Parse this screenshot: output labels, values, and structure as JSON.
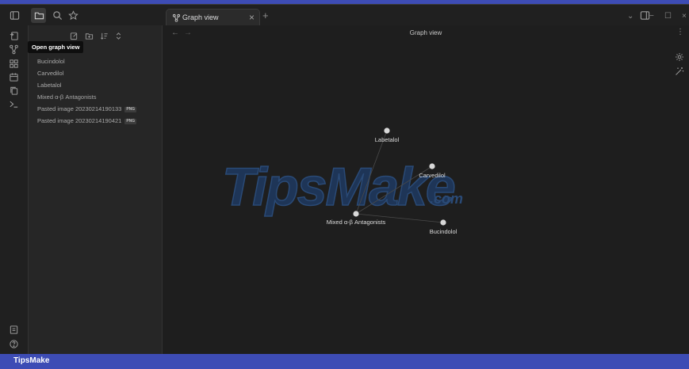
{
  "tab": {
    "label": "Graph view",
    "close": "×",
    "new": "+"
  },
  "tooltip": "Open graph view",
  "files": [
    {
      "name": "Bucindolol"
    },
    {
      "name": "Carvedilol"
    },
    {
      "name": "Labetalol"
    },
    {
      "name": "Mixed α-β Antagonists"
    },
    {
      "name": "Pasted image 20230214190133",
      "badge": "PNG"
    },
    {
      "name": "Pasted image 20230214190421",
      "badge": "PNG"
    }
  ],
  "graph": {
    "title": "Graph view",
    "nav_back": "←",
    "nav_fwd": "→",
    "more": "⋮",
    "nodes": [
      {
        "id": "labetalol",
        "label": "Labetalol"
      },
      {
        "id": "carvedilol",
        "label": "Carvedilol"
      },
      {
        "id": "mixed",
        "label": "Mixed α-β Antagonists"
      },
      {
        "id": "bucindolol",
        "label": "Bucindolol"
      }
    ],
    "edges": [
      [
        "labetalol",
        "mixed"
      ],
      [
        "carvedilol",
        "mixed"
      ],
      [
        "bucindolol",
        "mixed"
      ]
    ],
    "colors": {
      "node": "#d8d8d8",
      "edge": "#4a4a4a",
      "background": "#1e1e1e"
    }
  },
  "window": {
    "minimize": "−",
    "maximize": "☐",
    "close": "×",
    "chevron": "⌄"
  },
  "watermark": {
    "main": "TipsMake",
    "suffix": ".com"
  },
  "footer": {
    "label": "TipsMake",
    "color": "#3d4cb5"
  }
}
